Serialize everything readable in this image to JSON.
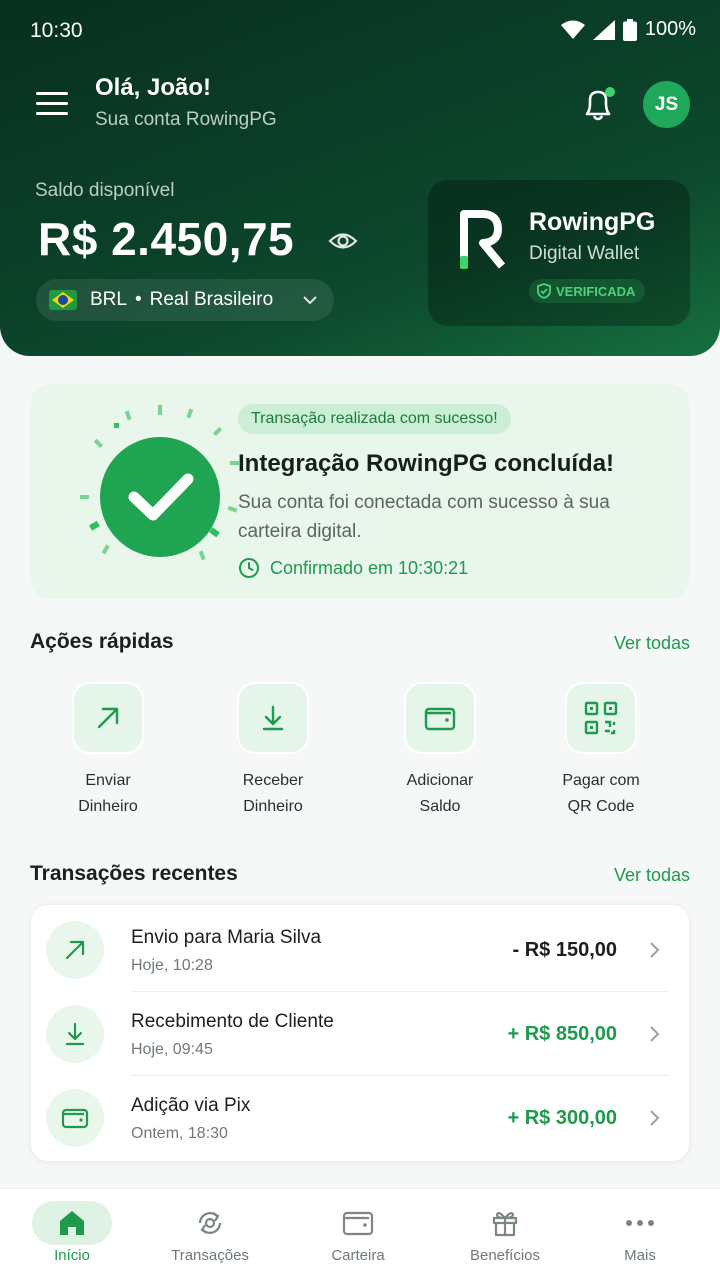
{
  "status_bar": {
    "time": "10:30",
    "battery": "100%"
  },
  "header": {
    "greeting": "Olá, João!",
    "subtitle": "Sua conta RowingPG",
    "avatar_initials": "JS",
    "notification_dot": true
  },
  "balance": {
    "label": "Saldo disponível",
    "value": "R$ 2.450,75",
    "currency_code": "BRL",
    "currency_name": "Real Brasileiro",
    "separator": "•"
  },
  "brand_card": {
    "name": "RowingPG",
    "subtitle": "Digital Wallet",
    "badge": "VERIFICADA"
  },
  "success": {
    "badge": "Transação realizada com sucesso!",
    "title": "Integração RowingPG concluída!",
    "description": "Sua conta foi conectada com sucesso à sua carteira digital.",
    "confirmed": "Confirmado em 10:30:21"
  },
  "quick_actions": {
    "title": "Ações rápidas",
    "see_all": "Ver todas",
    "items": [
      {
        "label": "Enviar\nDinheiro",
        "icon": "arrow-up-right-icon"
      },
      {
        "label": "Receber\nDinheiro",
        "icon": "download-icon"
      },
      {
        "label": "Adicionar\nSaldo",
        "icon": "wallet-icon"
      },
      {
        "label": "Pagar com\nQR Code",
        "icon": "qr-code-icon"
      }
    ]
  },
  "transactions": {
    "title": "Transações recentes",
    "see_all": "Ver todas",
    "items": [
      {
        "title": "Envio para Maria Silva",
        "time": "Hoje, 10:28",
        "amount": "- R$ 150,00",
        "type": "out",
        "icon": "arrow-up-right-icon"
      },
      {
        "title": "Recebimento de Cliente",
        "time": "Hoje, 09:45",
        "amount": "+ R$ 850,00",
        "type": "in",
        "icon": "download-icon"
      },
      {
        "title": "Adição via Pix",
        "time": "Ontem, 18:30",
        "amount": "+ R$ 300,00",
        "type": "in",
        "icon": "wallet-icon"
      }
    ]
  },
  "bottom_nav": {
    "items": [
      {
        "label": "Início",
        "icon": "home-icon",
        "active": true
      },
      {
        "label": "Transações",
        "icon": "transactions-icon",
        "active": false
      },
      {
        "label": "Carteira",
        "icon": "wallet-icon",
        "active": false
      },
      {
        "label": "Benefícios",
        "icon": "gift-icon",
        "active": false
      },
      {
        "label": "Mais",
        "icon": "more-icon",
        "active": false
      }
    ]
  },
  "colors": {
    "header_dark": "#08301f",
    "brand_green": "#1f9a4d",
    "light_green": "#e9f6ec",
    "negative_amount": "#1b1f1d"
  }
}
